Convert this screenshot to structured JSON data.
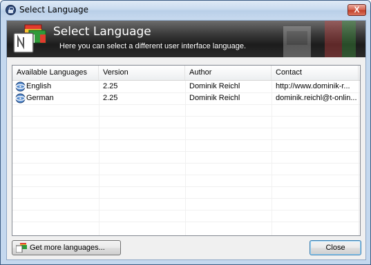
{
  "window": {
    "title": "Select Language",
    "close_glyph": "X",
    "icon": "lock-icon"
  },
  "banner": {
    "title": "Select Language",
    "subtitle": "Here you can select a different user interface language.",
    "icon": "language-flags-icon"
  },
  "list": {
    "columns": [
      "Available Languages",
      "Version",
      "Author",
      "Contact"
    ],
    "rows": [
      {
        "language": "English",
        "version": "2.25",
        "author": "Dominik Reichl",
        "contact": "http://www.dominik-r...",
        "icon": "language-globe-icon"
      },
      {
        "language": "German",
        "version": "2.25",
        "author": "Dominik Reichl",
        "contact": "dominik.reichl@t-onlin...",
        "icon": "language-globe-icon"
      }
    ]
  },
  "buttons": {
    "get_more": "Get more languages...",
    "close": "Close"
  },
  "colors": {
    "banner_dark": "#1c1c1c",
    "window_frame": "#c4d8ee",
    "close_red": "#c2412a"
  }
}
